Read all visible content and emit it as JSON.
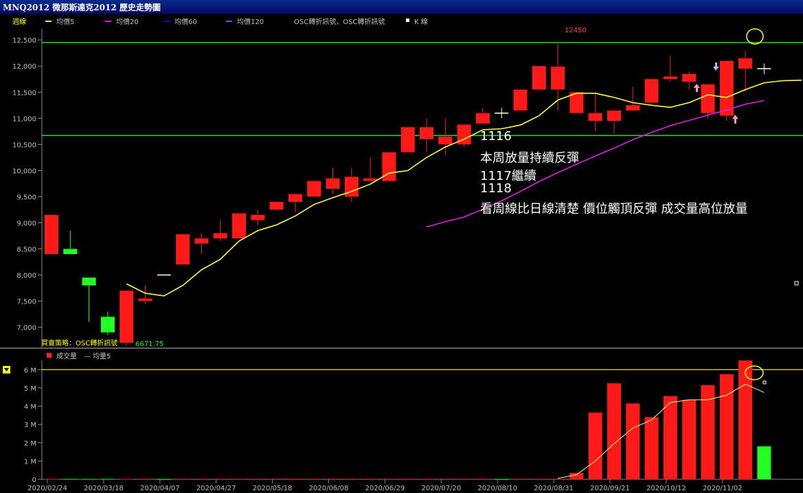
{
  "window": {
    "title": "MNQ2012 微那斯達克2012  歷史走勢圖"
  },
  "legend": {
    "period": "週線",
    "items": [
      {
        "label": "均價5",
        "color": "#ffff00"
      },
      {
        "label": "均價20",
        "color": "#ff00ff"
      },
      {
        "label": "均價60",
        "color": "#0000ff"
      },
      {
        "label": "均價120",
        "color": "#8040ff"
      },
      {
        "label": "OSC轉折訊號，OSC轉折訊號",
        "color": "#ffffff"
      },
      {
        "label": "K 線",
        "color": "#ffffff"
      }
    ]
  },
  "price_panel": {
    "peak_label": "12450",
    "strategy_label": "買賣策略：OSC轉折訊號",
    "strategy_value": "6671.75"
  },
  "volume_panel": {
    "legend_vol": "成交量",
    "legend_ma": "均量5",
    "legend_dash": "—"
  },
  "annotations": [
    "1116",
    "本周放量持續反彈",
    "1117繼續",
    "1118",
    "看周線比日線清楚  價位觸頂反彈 成交量高位放量"
  ],
  "chart_data": [
    {
      "type": "candlestick",
      "ylim": [
        6600,
        12700
      ],
      "y_ticks": [
        7000,
        7500,
        8000,
        8500,
        9000,
        9500,
        10000,
        10500,
        11000,
        11500,
        12000,
        12500
      ],
      "y_tick_labels": [
        "7,000",
        "7,500",
        "8,000",
        "8,500",
        "9,000",
        "9,500",
        "10,000",
        "10,500",
        "11,000",
        "11,500",
        "12,000",
        "12,500"
      ],
      "horizontal_lines": [
        12450,
        10670
      ],
      "x_labels": [
        "2020/02/24",
        "2020/03/18",
        "2020/04/07",
        "2020/04/27",
        "2020/05/18",
        "2020/06/08",
        "2020/06/29",
        "2020/07/20",
        "2020/08/10",
        "2020/08/31",
        "2020/09/21",
        "2020/10/12",
        "2020/11/02"
      ],
      "x_label_bar_index": [
        0,
        3,
        6,
        9,
        12,
        15,
        18,
        21,
        24,
        27,
        30,
        33,
        36
      ],
      "candles": [
        {
          "o": 8400,
          "h": 9150,
          "l": 8400,
          "c": 9150
        },
        {
          "o": 8500,
          "h": 8850,
          "l": 8400,
          "c": 8400
        },
        {
          "o": 7950,
          "h": 7950,
          "l": 7100,
          "c": 7800
        },
        {
          "o": 7200,
          "h": 7300,
          "l": 6850,
          "c": 6900
        },
        {
          "o": 6700,
          "h": 7700,
          "l": 6650,
          "c": 7700
        },
        {
          "o": 7500,
          "h": 7800,
          "l": 7450,
          "c": 7550
        },
        {
          "o": 8000,
          "h": 8000,
          "l": 8000,
          "c": 8000
        },
        {
          "o": 8200,
          "h": 8780,
          "l": 8200,
          "c": 8780
        },
        {
          "o": 8600,
          "h": 8800,
          "l": 8400,
          "c": 8700
        },
        {
          "o": 8700,
          "h": 9050,
          "l": 8650,
          "c": 8800
        },
        {
          "o": 8700,
          "h": 9180,
          "l": 8700,
          "c": 9180
        },
        {
          "o": 9050,
          "h": 9250,
          "l": 8950,
          "c": 9150
        },
        {
          "o": 9250,
          "h": 9400,
          "l": 9250,
          "c": 9400
        },
        {
          "o": 9400,
          "h": 9550,
          "l": 9200,
          "c": 9550
        },
        {
          "o": 9500,
          "h": 9800,
          "l": 9500,
          "c": 9800
        },
        {
          "o": 9650,
          "h": 10050,
          "l": 9550,
          "c": 9850
        },
        {
          "o": 9500,
          "h": 10050,
          "l": 9400,
          "c": 9880
        },
        {
          "o": 9800,
          "h": 10250,
          "l": 9800,
          "c": 9850
        },
        {
          "o": 9800,
          "h": 10350,
          "l": 9800,
          "c": 10350
        },
        {
          "o": 10350,
          "h": 10830,
          "l": 10350,
          "c": 10830
        },
        {
          "o": 10600,
          "h": 11000,
          "l": 10350,
          "c": 10830
        },
        {
          "o": 10500,
          "h": 11000,
          "l": 10300,
          "c": 10650
        },
        {
          "o": 10500,
          "h": 10880,
          "l": 10450,
          "c": 10880
        },
        {
          "o": 10900,
          "h": 11200,
          "l": 10900,
          "c": 11100
        },
        {
          "o": 11100,
          "h": 11200,
          "l": 11000,
          "c": 11100
        },
        {
          "o": 11150,
          "h": 11550,
          "l": 11150,
          "c": 11550
        },
        {
          "o": 11550,
          "h": 12000,
          "l": 11550,
          "c": 12000
        },
        {
          "o": 11550,
          "h": 12450,
          "l": 11150,
          "c": 11990
        },
        {
          "o": 11100,
          "h": 11500,
          "l": 11100,
          "c": 11500
        },
        {
          "o": 10950,
          "h": 11500,
          "l": 10750,
          "c": 11100
        },
        {
          "o": 10950,
          "h": 11150,
          "l": 10700,
          "c": 11150
        },
        {
          "o": 11150,
          "h": 11600,
          "l": 11150,
          "c": 11250
        },
        {
          "o": 11300,
          "h": 11750,
          "l": 11300,
          "c": 11750
        },
        {
          "o": 11750,
          "h": 12200,
          "l": 11700,
          "c": 11800
        },
        {
          "o": 11700,
          "h": 11900,
          "l": 11550,
          "c": 11850
        },
        {
          "o": 11100,
          "h": 11650,
          "l": 11000,
          "c": 11650
        },
        {
          "o": 11050,
          "h": 12100,
          "l": 10950,
          "c": 12100
        },
        {
          "o": 11950,
          "h": 12300,
          "l": 11500,
          "c": 12150
        },
        {
          "o": 11950,
          "h": 12050,
          "l": 11850,
          "c": 11950
        }
      ],
      "series": [
        {
          "name": "均價5",
          "start_index": 4,
          "values": [
            7830,
            7650,
            7600,
            7800,
            8100,
            8300,
            8650,
            8850,
            8960,
            9130,
            9350,
            9480,
            9600,
            9740,
            9950,
            10000,
            10250,
            10450,
            10600,
            10780,
            10800,
            10870,
            11050,
            11350,
            11480,
            11480,
            11400,
            11300,
            11250,
            11210,
            11300,
            11450,
            11400,
            11550,
            11680,
            11720,
            11730
          ]
        },
        {
          "name": "均價20",
          "start_index": 20,
          "values": [
            8920,
            9020,
            9110,
            9260,
            9420,
            9600,
            9790,
            9960,
            10120,
            10280,
            10430,
            10590,
            10730,
            10860,
            10960,
            11060,
            11160,
            11270,
            11340
          ]
        }
      ]
    },
    {
      "type": "bar",
      "ylim": [
        0,
        6.5
      ],
      "y_ticks": [
        0,
        1,
        2,
        3,
        4,
        5,
        6
      ],
      "y_tick_labels": [
        "0",
        "1 M",
        "2 M",
        "3 M",
        "4 M",
        "5 M",
        "6 M"
      ],
      "horizontal_lines": [
        6
      ],
      "unit": "M",
      "values": [
        0.02,
        0.02,
        0.02,
        0.02,
        0.02,
        0.01,
        0.01,
        0.01,
        0.01,
        0.01,
        0.01,
        0.01,
        0.01,
        0.01,
        0.01,
        0.01,
        0.01,
        0.01,
        0.01,
        0.01,
        0.01,
        0.01,
        0.01,
        0.01,
        0.01,
        0.01,
        0.01,
        0.01,
        0.35,
        3.65,
        5.25,
        4.15,
        3.4,
        4.55,
        4.35,
        5.15,
        5.75,
        6.5,
        1.8
      ],
      "series": [
        {
          "name": "均量5",
          "start_index": 27,
          "values": [
            0.05,
            0.25,
            1.0,
            1.95,
            2.8,
            3.25,
            4.2,
            4.35,
            4.35,
            4.6,
            5.2,
            4.75
          ]
        }
      ]
    }
  ]
}
